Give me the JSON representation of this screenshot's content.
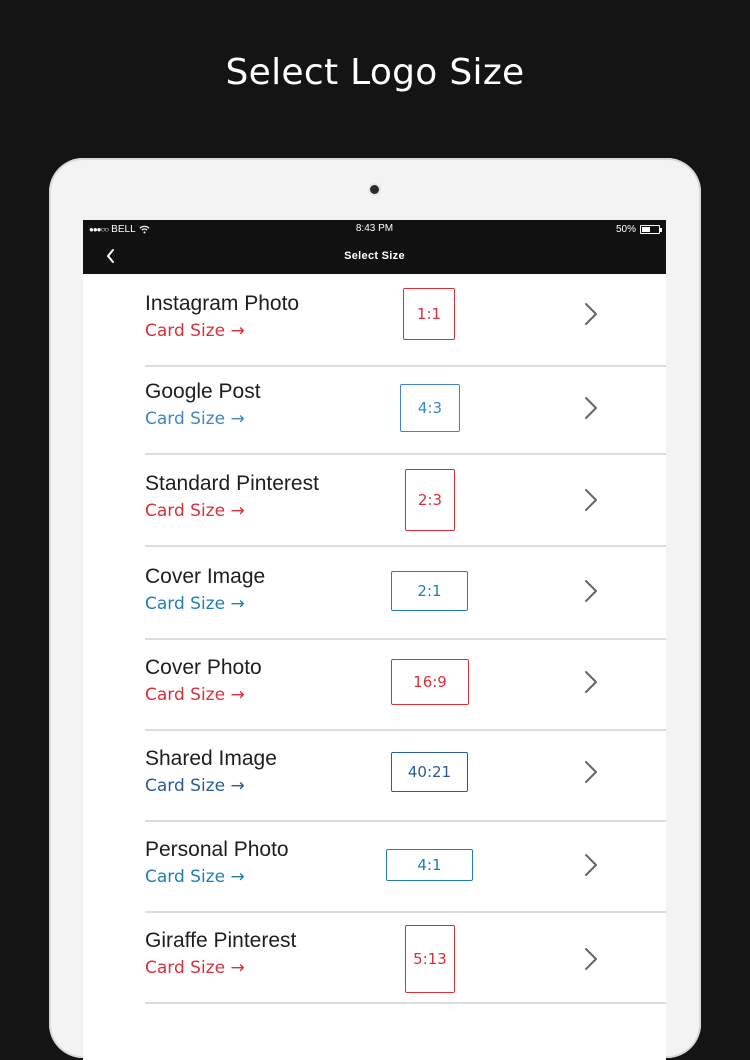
{
  "headline": "Select Logo Size",
  "status_bar": {
    "carrier": "BELL",
    "signal": "●●●○○",
    "time": "8:43 PM",
    "battery_percent": "50%",
    "battery_level": 0.5
  },
  "nav": {
    "back_icon": "chevron-left-icon",
    "title": "Select Size"
  },
  "colors": {
    "red": "#d8303a",
    "blue": "#2f79b9",
    "teal_blue": "#1e7fb0",
    "navy_blue": "#2a5a9a"
  },
  "items": [
    {
      "title": "Instagram Photo",
      "subtitle": "Card Size →",
      "ratio": "1:1",
      "color": "#d8303a"
    },
    {
      "title": "Google Post",
      "subtitle": "Card Size →",
      "ratio": "4:3",
      "color": "#3f86c6"
    },
    {
      "title": "Standard Pinterest",
      "subtitle": "Card Size →",
      "ratio": "2:3",
      "color": "#d8303a"
    },
    {
      "title": "Cover Image",
      "subtitle": "Card Size →",
      "ratio": "2:1",
      "color": "#1e7fb0"
    },
    {
      "title": "Cover Photo",
      "subtitle": "Card Size →",
      "ratio": "16:9",
      "color": "#d8303a"
    },
    {
      "title": "Shared Image",
      "subtitle": "Card Size →",
      "ratio": "40:21",
      "color": "#2a5a9a"
    },
    {
      "title": "Personal Photo",
      "subtitle": "Card Size →",
      "ratio": "4:1",
      "color": "#1e7fb0"
    },
    {
      "title": "Giraffe Pinterest",
      "subtitle": "Card Size →",
      "ratio": "5:13",
      "color": "#d8303a"
    }
  ]
}
